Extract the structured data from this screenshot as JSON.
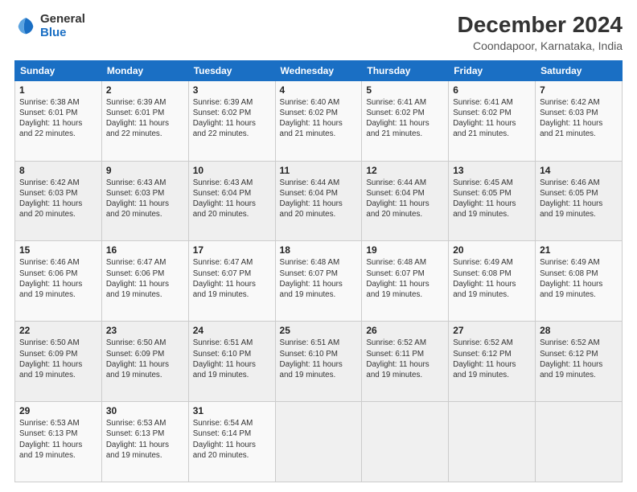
{
  "logo": {
    "line1": "General",
    "line2": "Blue"
  },
  "title": "December 2024",
  "subtitle": "Coondapoor, Karnataka, India",
  "days_header": [
    "Sunday",
    "Monday",
    "Tuesday",
    "Wednesday",
    "Thursday",
    "Friday",
    "Saturday"
  ],
  "weeks": [
    [
      {
        "day": "1",
        "sunrise": "6:38 AM",
        "sunset": "6:01 PM",
        "daylight": "11 hours and 22 minutes."
      },
      {
        "day": "2",
        "sunrise": "6:39 AM",
        "sunset": "6:01 PM",
        "daylight": "11 hours and 22 minutes."
      },
      {
        "day": "3",
        "sunrise": "6:39 AM",
        "sunset": "6:02 PM",
        "daylight": "11 hours and 22 minutes."
      },
      {
        "day": "4",
        "sunrise": "6:40 AM",
        "sunset": "6:02 PM",
        "daylight": "11 hours and 21 minutes."
      },
      {
        "day": "5",
        "sunrise": "6:41 AM",
        "sunset": "6:02 PM",
        "daylight": "11 hours and 21 minutes."
      },
      {
        "day": "6",
        "sunrise": "6:41 AM",
        "sunset": "6:02 PM",
        "daylight": "11 hours and 21 minutes."
      },
      {
        "day": "7",
        "sunrise": "6:42 AM",
        "sunset": "6:03 PM",
        "daylight": "11 hours and 21 minutes."
      }
    ],
    [
      {
        "day": "8",
        "sunrise": "6:42 AM",
        "sunset": "6:03 PM",
        "daylight": "11 hours and 20 minutes."
      },
      {
        "day": "9",
        "sunrise": "6:43 AM",
        "sunset": "6:03 PM",
        "daylight": "11 hours and 20 minutes."
      },
      {
        "day": "10",
        "sunrise": "6:43 AM",
        "sunset": "6:04 PM",
        "daylight": "11 hours and 20 minutes."
      },
      {
        "day": "11",
        "sunrise": "6:44 AM",
        "sunset": "6:04 PM",
        "daylight": "11 hours and 20 minutes."
      },
      {
        "day": "12",
        "sunrise": "6:44 AM",
        "sunset": "6:04 PM",
        "daylight": "11 hours and 20 minutes."
      },
      {
        "day": "13",
        "sunrise": "6:45 AM",
        "sunset": "6:05 PM",
        "daylight": "11 hours and 19 minutes."
      },
      {
        "day": "14",
        "sunrise": "6:46 AM",
        "sunset": "6:05 PM",
        "daylight": "11 hours and 19 minutes."
      }
    ],
    [
      {
        "day": "15",
        "sunrise": "6:46 AM",
        "sunset": "6:06 PM",
        "daylight": "11 hours and 19 minutes."
      },
      {
        "day": "16",
        "sunrise": "6:47 AM",
        "sunset": "6:06 PM",
        "daylight": "11 hours and 19 minutes."
      },
      {
        "day": "17",
        "sunrise": "6:47 AM",
        "sunset": "6:07 PM",
        "daylight": "11 hours and 19 minutes."
      },
      {
        "day": "18",
        "sunrise": "6:48 AM",
        "sunset": "6:07 PM",
        "daylight": "11 hours and 19 minutes."
      },
      {
        "day": "19",
        "sunrise": "6:48 AM",
        "sunset": "6:07 PM",
        "daylight": "11 hours and 19 minutes."
      },
      {
        "day": "20",
        "sunrise": "6:49 AM",
        "sunset": "6:08 PM",
        "daylight": "11 hours and 19 minutes."
      },
      {
        "day": "21",
        "sunrise": "6:49 AM",
        "sunset": "6:08 PM",
        "daylight": "11 hours and 19 minutes."
      }
    ],
    [
      {
        "day": "22",
        "sunrise": "6:50 AM",
        "sunset": "6:09 PM",
        "daylight": "11 hours and 19 minutes."
      },
      {
        "day": "23",
        "sunrise": "6:50 AM",
        "sunset": "6:09 PM",
        "daylight": "11 hours and 19 minutes."
      },
      {
        "day": "24",
        "sunrise": "6:51 AM",
        "sunset": "6:10 PM",
        "daylight": "11 hours and 19 minutes."
      },
      {
        "day": "25",
        "sunrise": "6:51 AM",
        "sunset": "6:10 PM",
        "daylight": "11 hours and 19 minutes."
      },
      {
        "day": "26",
        "sunrise": "6:52 AM",
        "sunset": "6:11 PM",
        "daylight": "11 hours and 19 minutes."
      },
      {
        "day": "27",
        "sunrise": "6:52 AM",
        "sunset": "6:12 PM",
        "daylight": "11 hours and 19 minutes."
      },
      {
        "day": "28",
        "sunrise": "6:52 AM",
        "sunset": "6:12 PM",
        "daylight": "11 hours and 19 minutes."
      }
    ],
    [
      {
        "day": "29",
        "sunrise": "6:53 AM",
        "sunset": "6:13 PM",
        "daylight": "11 hours and 19 minutes."
      },
      {
        "day": "30",
        "sunrise": "6:53 AM",
        "sunset": "6:13 PM",
        "daylight": "11 hours and 19 minutes."
      },
      {
        "day": "31",
        "sunrise": "6:54 AM",
        "sunset": "6:14 PM",
        "daylight": "11 hours and 20 minutes."
      },
      null,
      null,
      null,
      null
    ]
  ]
}
